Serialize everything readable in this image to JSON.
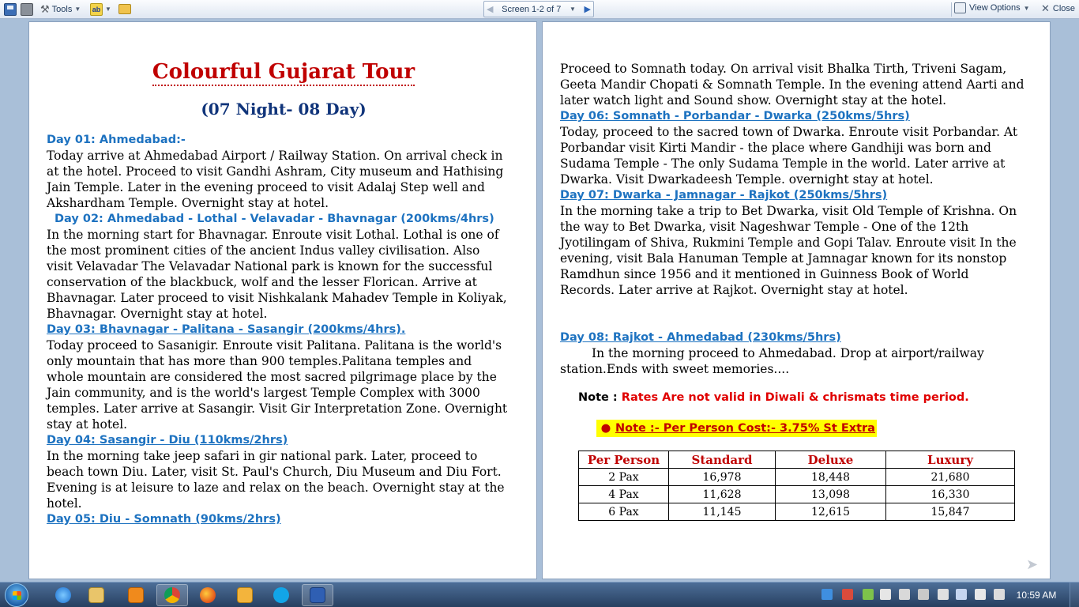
{
  "toolbar": {
    "tools_label": "Tools",
    "screen_label": "Screen 1-2 of 7",
    "view_options_label": "View Options",
    "close_label": "Close"
  },
  "tour": {
    "title": "Colourful  Gujarat Tour",
    "duration": "(07 Night- 08 Day)"
  },
  "days": [
    {
      "heading": "Day 01: Ahmedabad:-",
      "text": "Today arrive at Ahmedabad Airport / Railway Station. On arrival check in at the hotel. Proceed to visit Gandhi Ashram, City museum and Hathising Jain Temple. Later in the evening proceed to visit Adalaj Step well and Akshardham Temple. Overnight stay at hotel."
    },
    {
      "heading": "Day 02: Ahmedabad - Lothal - Velavadar - Bhavnagar (200kms/4hrs)",
      "text": "In the morning start for Bhavnagar. Enroute visit Lothal. Lothal is one of the most prominent cities of the ancient Indus valley civilisation. Also visit Velavadar The Velavadar National park is known for the successful conservation of the blackbuck, wolf and the lesser Florican. Arrive at Bhavnagar. Later proceed to visit Nishkalank Mahadev Temple in Koliyak, Bhavnagar. Overnight stay at hotel."
    },
    {
      "heading": "Day 03: Bhavnagar - Palitana - Sasangir (200kms/4hrs).",
      "text": "Today proceed to Sasanigir. Enroute visit Palitana. Palitana is the world's only mountain that has more than 900 temples.Palitana temples and whole mountain are considered the most sacred pilgrimage place by the Jain community, and is the world's largest Temple Complex with 3000 temples. Later arrive at Sasangir. Visit Gir Interpretation Zone. Overnight stay at hotel."
    },
    {
      "heading": "Day 04: Sasangir - Diu (110kms/2hrs)",
      "text": "In the morning take jeep safari in gir national park. Later, proceed to beach town Diu. Later, visit St. Paul's Church, Diu Museum and Diu Fort. Evening is at leisure to laze and relax on the beach. Overnight stay at the hotel."
    },
    {
      "heading": "Day 05: Diu - Somnath (90kms/2hrs)",
      "text": "Proceed to Somnath today. On arrival visit Bhalka Tirth, Triveni Sagam, Geeta Mandir Chopati & Somnath Temple. In the evening attend Aarti and later watch light and Sound show. Overnight stay at the hotel."
    },
    {
      "heading": "Day 06: Somnath - Porbandar - Dwarka (250kms/5hrs)",
      "text": "Today, proceed to the sacred town of Dwarka. Enroute visit Porbandar. At Porbandar visit Kirti Mandir - the place where Gandhiji was born and Sudama Temple - The only Sudama Temple in the world. Later arrive at Dwarka. Visit Dwarkadeesh Temple. overnight stay at hotel."
    },
    {
      "heading": "Day 07: Dwarka - Jamnagar - Rajkot (250kms/5hrs)",
      "text": "In the morning take a trip to Bet Dwarka, visit Old Temple of Krishna. On the way to Bet Dwarka, visit Nageshwar Temple - One of the 12th Jyotilingam of Shiva, Rukmini Temple and Gopi Talav. Enroute visit In the evening, visit Bala Hanuman Temple at Jamnagar known for its nonstop Ramdhun since 1956 and it mentioned in Guinness Book of World Records. Later arrive at Rajkot. Overnight stay at hotel."
    },
    {
      "heading": "Day 08: Rajkot - Ahmedabad (230kms/5hrs)",
      "text": "In the morning proceed to Ahmedabad. Drop at airport/railway station.Ends with sweet memories...."
    }
  ],
  "notes": {
    "note1_label": "Note :",
    "note1_text": "Rates Are not valid in Diwali & chrismats time period.",
    "note2_text": "Note :- Per Person Cost:- 3.75% St Extra"
  },
  "price_table": {
    "headers": [
      "Per Person",
      "Standard",
      "Deluxe",
      "Luxury"
    ],
    "rows": [
      [
        "2 Pax",
        "16,978",
        "18,448",
        "21,680"
      ],
      [
        "4 Pax",
        "11,628",
        "13,098",
        "16,330"
      ],
      [
        "6 Pax",
        "11,145",
        "12,615",
        "15,847"
      ]
    ]
  },
  "taskbar": {
    "clock": "10:59 AM",
    "apps": [
      "internet-explorer",
      "windows-explorer",
      "media-player",
      "chrome",
      "firefox",
      "messenger",
      "skype",
      "word"
    ]
  },
  "colors": {
    "heading_blue": "#1d72c0",
    "title_red": "#c00000",
    "subtitle_navy": "#10347a",
    "note_red": "#e00000",
    "highlight_yellow": "#ffff00"
  }
}
